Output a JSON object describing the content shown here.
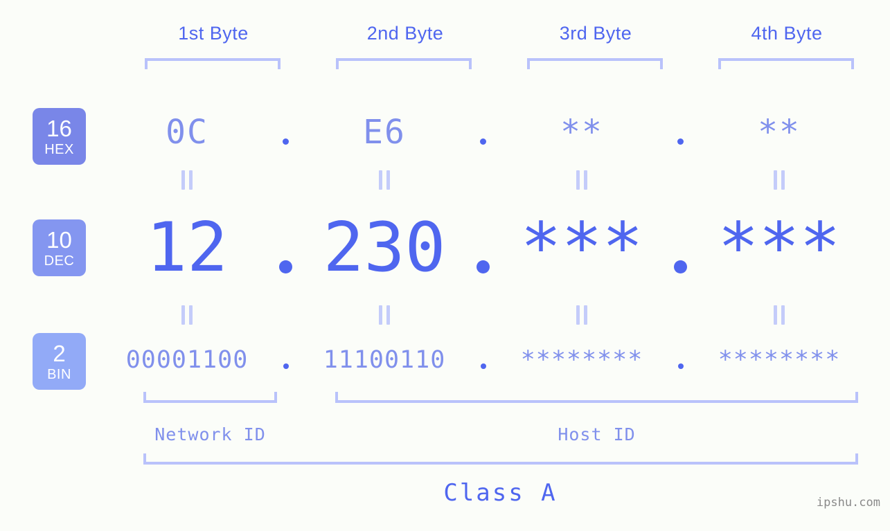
{
  "byte_headers": [
    {
      "label": "1st Byte"
    },
    {
      "label": "2nd Byte"
    },
    {
      "label": "3rd Byte"
    },
    {
      "label": "4th Byte"
    }
  ],
  "bases": [
    {
      "number": "16",
      "name": "HEX",
      "color": "#7986e8"
    },
    {
      "number": "10",
      "name": "DEC",
      "color": "#8496f0"
    },
    {
      "number": "2",
      "name": "BIN",
      "color": "#92aaf7"
    }
  ],
  "rows": {
    "hex": {
      "base_number": "16",
      "base_name": "HEX",
      "bytes": [
        "0C",
        "E6",
        "**",
        "**"
      ]
    },
    "dec": {
      "base_number": "10",
      "base_name": "DEC",
      "bytes": [
        "12",
        "230",
        "***",
        "***"
      ]
    },
    "bin": {
      "base_number": "2",
      "base_name": "BIN",
      "bytes": [
        "00001100",
        "11100110",
        "********",
        "********"
      ]
    }
  },
  "separator": ".",
  "equals_symbol": "=",
  "structure": {
    "network_id_label": "Network ID",
    "host_id_label": "Host ID",
    "class_label": "Class A"
  },
  "watermark": "ipshu.com",
  "colors": {
    "background": "#fbfdf9",
    "accent_strong": "#4f66ef",
    "accent_light": "#8090ec",
    "bracket": "#b9c2fb",
    "connector": "#c4ccfa"
  }
}
